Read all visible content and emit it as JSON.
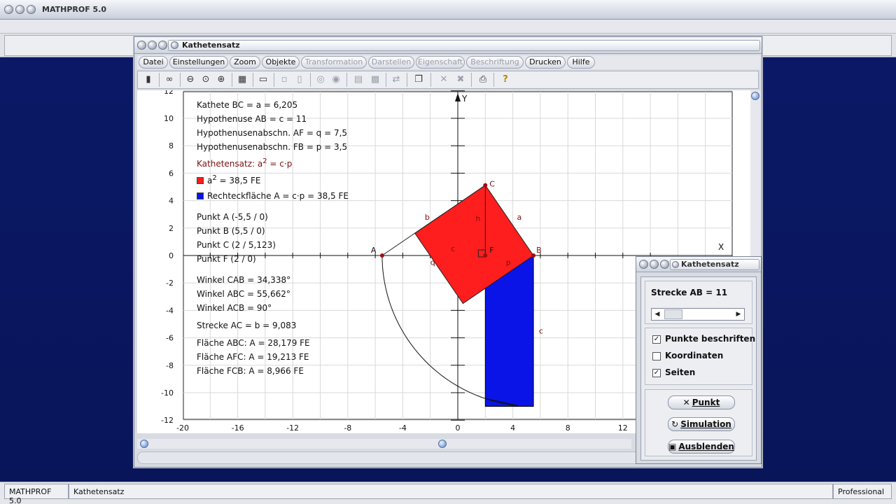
{
  "app": {
    "title": "MATHPROF 5.0"
  },
  "statusbar": {
    "app_name": "MATHPROF 5.0",
    "module": "Kathetensatz",
    "edition": "Professional"
  },
  "window": {
    "title": "Kathetensatz",
    "menu": [
      {
        "label": "Datei",
        "enabled": true
      },
      {
        "label": "Einstellungen",
        "enabled": true
      },
      {
        "label": "Zoom",
        "enabled": true
      },
      {
        "label": "Objekte",
        "enabled": true
      },
      {
        "label": "Transformation",
        "enabled": false
      },
      {
        "label": "Darstellen",
        "enabled": false
      },
      {
        "label": "Eigenschaft",
        "enabled": false
      },
      {
        "label": "Beschriftung",
        "enabled": false
      },
      {
        "label": "Drucken",
        "enabled": true
      },
      {
        "label": "Hilfe",
        "enabled": true
      }
    ],
    "toolbar_icons": [
      "exit-icon",
      "binoculars-icon",
      "zoom-out-icon",
      "zoom-reset-icon",
      "zoom-in-icon",
      "settings-icon",
      "window-icon",
      "grid-small-icon",
      "grid-medium-icon",
      "circle-icon",
      "circle-target-icon",
      "table-icon",
      "image-icon",
      "transfer-icon",
      "copy-icon",
      "delete-point-icon",
      "delete-all-icon",
      "print-icon",
      "help-icon"
    ]
  },
  "plot": {
    "x_axis_label": "X",
    "y_axis_label": "Y",
    "x_range": [
      -20,
      15
    ],
    "y_range": [
      -12,
      12
    ],
    "x_ticks": [
      "-20",
      "-16",
      "-12",
      "-8",
      "-4",
      "0",
      "4",
      "8",
      "12"
    ],
    "y_ticks": [
      "12",
      "10",
      "8",
      "6",
      "4",
      "2",
      "0",
      "-2",
      "-4",
      "-6",
      "-8",
      "-10",
      "-12"
    ],
    "points": {
      "A": {
        "label": "A",
        "x": -5.5,
        "y": 0
      },
      "B": {
        "label": "B",
        "x": 5.5,
        "y": 0
      },
      "C": {
        "label": "C",
        "x": 2,
        "y": 5.123
      },
      "F": {
        "label": "F",
        "x": 2,
        "y": 0
      }
    },
    "segment_labels": {
      "b": "b",
      "h": "h",
      "a": "a",
      "c_axis": "c",
      "q": "q",
      "p": "p",
      "c_rect": "c"
    },
    "colors": {
      "square": "#ff1e1e",
      "rectangle": "#0a14e6",
      "point": "#9b1010",
      "label": "#7a1010"
    }
  },
  "info": {
    "kathete": "Kathete BC = a = 6,205",
    "hypotenuse": "Hypothenuse AB = c = 11",
    "abschn_q": "Hypothenusenabschn. AF = q = 7,5",
    "abschn_p": "Hypothenusenabschn. FB = p = 3,5",
    "satz_prefix": "Kathetensatz: a",
    "satz_exp": "2",
    "satz_suffix": " = c·p",
    "sq_prefix": "a",
    "sq_exp": "2",
    "sq_suffix": " = 38,5 FE",
    "rect": "Rechteckfläche A = c·p = 38,5 FE",
    "punkt_a": "Punkt A (-5,5 / 0)",
    "punkt_b": "Punkt B (5,5 / 0)",
    "punkt_c": "Punkt C (2 / 5,123)",
    "punkt_f": "Punkt F (2 / 0)",
    "winkel_cab": "Winkel CAB = 34,338°",
    "winkel_abc": "Winkel ABC = 55,662°",
    "winkel_acb": "Winkel ACB = 90°",
    "strecke_ac": "Strecke AC = b = 9,083",
    "flaeche_abc": "Fläche ABC: A = 28,179 FE",
    "flaeche_afc": "Fläche AFC: A = 19,213 FE",
    "flaeche_fcb": "Fläche FCB: A = 8,966 FE"
  },
  "dialog": {
    "title": "Kathetensatz",
    "strecke_label": "Strecke  AB = 11",
    "slider_value": 11,
    "checkboxes": [
      {
        "label": "Punkte beschriften",
        "checked": true
      },
      {
        "label": "Koordinaten",
        "checked": false
      },
      {
        "label": "Seiten",
        "checked": true
      }
    ],
    "buttons": {
      "punkt": "Punkt",
      "simulation": "Simulation",
      "ausblenden": "Ausblenden"
    }
  }
}
